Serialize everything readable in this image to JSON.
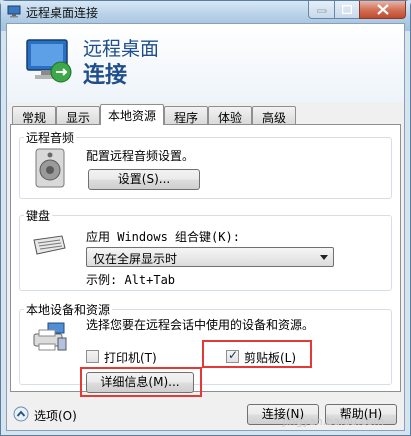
{
  "window": {
    "title": "远程桌面连接",
    "accent": "#1f4e8c"
  },
  "banner": {
    "line1": "远程桌面",
    "line2": "连接"
  },
  "tabs": [
    {
      "label": "常规"
    },
    {
      "label": "显示"
    },
    {
      "label": "本地资源",
      "active": true
    },
    {
      "label": "程序"
    },
    {
      "label": "体验"
    },
    {
      "label": "高级"
    }
  ],
  "audio": {
    "group_label": "远程音频",
    "description": "配置远程音频设置。",
    "settings_button": "设置(S)..."
  },
  "keyboard": {
    "group_label": "键盘",
    "apply_label": "应用 Windows 组合键(K):",
    "select_value": "仅在全屏显示时",
    "example": "示例: Alt+Tab"
  },
  "devices": {
    "group_label": "本地设备和资源",
    "description": "选择您要在远程会话中使用的设备和资源。",
    "printer_label": "打印机(T)",
    "printer_checked": false,
    "clipboard_label": "剪贴板(L)",
    "clipboard_checked": true,
    "details_button": "详细信息(M)..."
  },
  "footer": {
    "options_label": "选项(O)",
    "connect_button": "连接(N)",
    "help_button": "帮助(H)"
  },
  "watermark": "jingyan.baidu.com"
}
